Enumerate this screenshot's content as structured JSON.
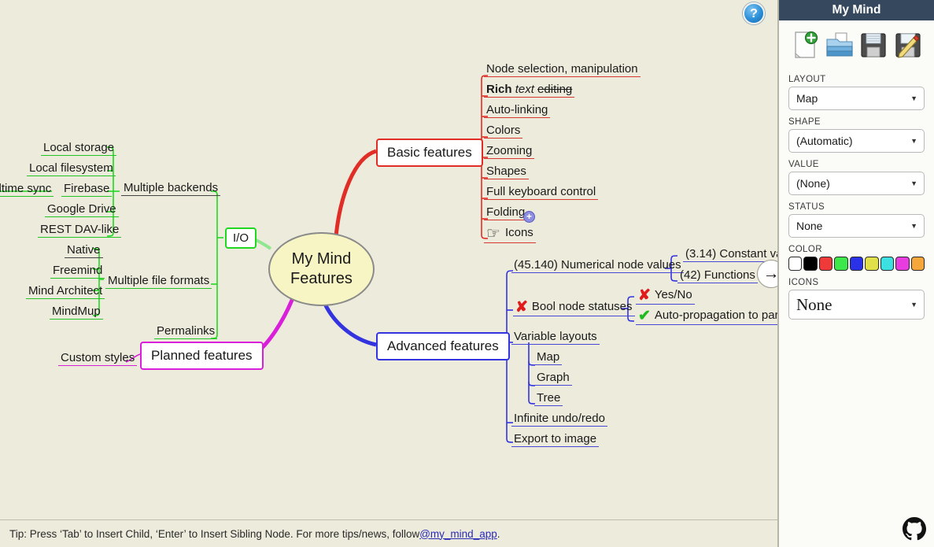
{
  "app": {
    "title": "My Mind",
    "help_icon": "question-mark-icon",
    "scroll_right_icon": "→",
    "github_icon": "github-icon"
  },
  "tip": {
    "text_before": "Tip: Press ‘Tab’ to Insert Child, ‘Enter’ to Insert Sibling Node. For more tips/news, follow ",
    "link": "@my_mind_app",
    "text_after": "."
  },
  "sidebar": {
    "title": "My Mind",
    "toolbar": [
      {
        "name": "new-document-button",
        "label": "new-document-icon"
      },
      {
        "name": "open-document-button",
        "label": "open-folder-icon"
      },
      {
        "name": "save-button",
        "label": "floppy-disk-icon"
      },
      {
        "name": "save-as-button",
        "label": "floppy-disk-pencil-icon"
      }
    ],
    "sections": {
      "layout": {
        "label": "LAYOUT",
        "value": "Map"
      },
      "shape": {
        "label": "SHAPE",
        "value": "(Automatic)"
      },
      "value": {
        "label": "VALUE",
        "value": "(None)"
      },
      "status": {
        "label": "STATUS",
        "value": "None"
      },
      "color": {
        "label": "COLOR"
      },
      "icons": {
        "label": "ICONS",
        "value": "None"
      }
    },
    "colors": [
      "#ffffff",
      "#000000",
      "#f03a3a",
      "#3ce84a",
      "#2a32e8",
      "#e2e04a",
      "#3ce0e0",
      "#e83ce0",
      "#f5a73c"
    ],
    "caret": "▼"
  },
  "mindmap": {
    "root": {
      "label": "My Mind\nFeatures",
      "line1": "My Mind",
      "line2": "Features"
    },
    "branches": {
      "basic": {
        "label": "Basic features",
        "color": "#e02d26"
      },
      "advanced": {
        "label": "Advanced features",
        "color": "#3333e0"
      },
      "io": {
        "label": "I/O",
        "color": "#20d820"
      },
      "planned": {
        "label": "Planned features",
        "color": "#d91fd9"
      }
    },
    "basic_children": [
      {
        "label": "Node selection, manipulation"
      },
      {
        "label": "Rich text editing",
        "rich": {
          "bold": "Rich",
          "italic": "text",
          "strike": "editing"
        }
      },
      {
        "label": "Auto-linking"
      },
      {
        "label": "Colors"
      },
      {
        "label": "Zooming"
      },
      {
        "label": "Shapes"
      },
      {
        "label": "Full keyboard control"
      },
      {
        "label": "Folding",
        "folded": "+"
      },
      {
        "label": "Icons",
        "icon": "pointing-hand-icon",
        "glyph": "☞"
      }
    ],
    "advanced_children": [
      {
        "label": "Numerical node values",
        "value_prefix": "(45.140)"
      },
      {
        "label": "Bool node statuses",
        "status": "✘"
      },
      {
        "label": "Variable layouts"
      },
      {
        "label": "Infinite undo/redo"
      },
      {
        "label": "Export to image"
      }
    ],
    "numerical_children": [
      {
        "label": "Constant value",
        "value_prefix": "(3.14)"
      },
      {
        "label": "Functions",
        "value_prefix": "(42)"
      }
    ],
    "bool_children": [
      {
        "label": "Yes/No",
        "status": "✘"
      },
      {
        "label": "Auto-propagation to parent",
        "status": "✔"
      }
    ],
    "layout_children": [
      {
        "label": "Map"
      },
      {
        "label": "Graph"
      },
      {
        "label": "Tree"
      }
    ],
    "io_children": [
      {
        "label": "Multiple backends"
      },
      {
        "label": "Multiple file formats"
      },
      {
        "label": "Permalinks"
      }
    ],
    "backend_children": [
      {
        "label": "Local storage"
      },
      {
        "label": "Local filesystem"
      },
      {
        "label": "Firebase"
      },
      {
        "label": "Google Drive"
      },
      {
        "label": "REST DAV-like"
      }
    ],
    "firebase_children": [
      {
        "label": "Realtime sync"
      }
    ],
    "format_children": [
      {
        "label": "Native"
      },
      {
        "label": "Freemind"
      },
      {
        "label": "Mind Architect"
      },
      {
        "label": "MindMup"
      }
    ],
    "planned_children": [
      {
        "label": "Custom styles"
      }
    ]
  }
}
